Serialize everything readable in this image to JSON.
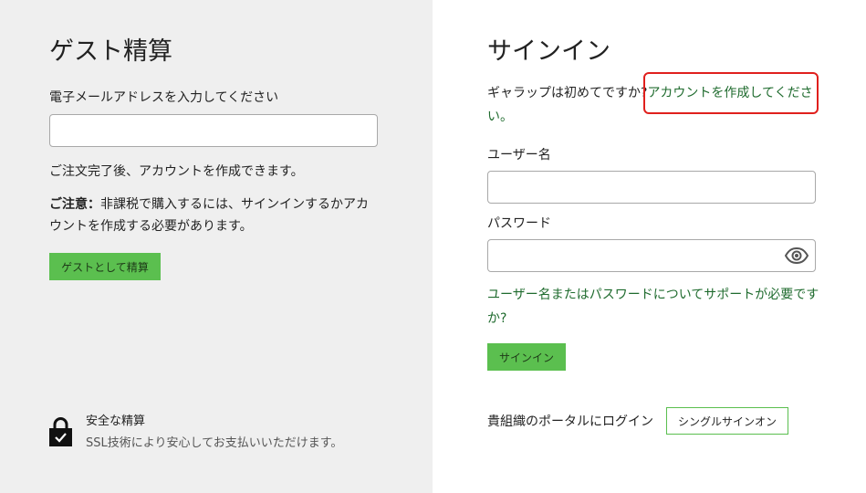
{
  "guest": {
    "title": "ゲスト精算",
    "email_label": "電子メールアドレスを入力してください",
    "email_value": "",
    "after_order_text": "ご注文完了後、アカウントを作成できます。",
    "note_bold": "ご注意：",
    "note_text": "非課税で購入するには、サインインするかアカウントを作成する必要があります。",
    "guest_button": "ゲストとして精算",
    "secure_title": "安全な精算",
    "secure_sub": "SSL技術により安心してお支払いいただけます。"
  },
  "signin": {
    "title": "サインイン",
    "first_time_text": "ギャラップは初めてですか?",
    "create_account_link": "アカウントを作成してください。",
    "username_label": "ユーザー名",
    "username_value": "",
    "password_label": "パスワード",
    "password_value": "",
    "help_link": "ユーザー名またはパスワードについてサポートが必要ですか?",
    "signin_button": "サインイン",
    "portal_text": "貴組織のポータルにログイン",
    "sso_button": "シングルサインオン"
  },
  "colors": {
    "accent_green": "#5bbf4f",
    "link_green": "#1f6b2e",
    "highlight_red": "#e0201d",
    "left_panel_bg": "#efefef"
  },
  "icons": {
    "lock": "lock-icon",
    "eye": "eye-icon"
  }
}
